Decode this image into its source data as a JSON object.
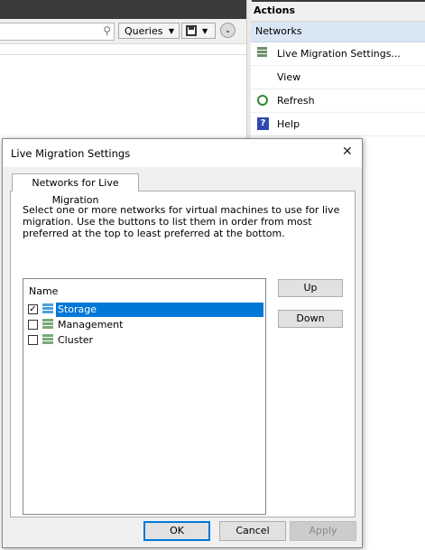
{
  "console": {
    "queries_label": "Queries",
    "dropdown_glyph": "▼",
    "search_glyph": "⚲",
    "collapse_glyph": "⌄"
  },
  "actions": {
    "header": "Actions",
    "section": "Networks",
    "items": [
      {
        "label": "Live Migration Settings...",
        "icon": "network-settings-icon"
      },
      {
        "label": "View",
        "icon": ""
      },
      {
        "label": "Refresh",
        "icon": "refresh-icon"
      },
      {
        "label": "Help",
        "icon": "help-icon",
        "glyph": "?"
      }
    ]
  },
  "dialog": {
    "title": "Live Migration Settings",
    "close_glyph": "✕",
    "tab_label": "Networks for Live Migration",
    "instructions": "Select one or more networks for virtual machines to use for live migration. Use the buttons to list them in order from most preferred at the top to least preferred at the bottom.",
    "list_header": "Name",
    "networks": [
      {
        "name": "Storage",
        "checked": true,
        "selected": true
      },
      {
        "name": "Management",
        "checked": false,
        "selected": false
      },
      {
        "name": "Cluster",
        "checked": false,
        "selected": false
      }
    ],
    "check_glyph": "✓",
    "up_label": "Up",
    "down_label": "Down",
    "ok_label": "OK",
    "cancel_label": "Cancel",
    "apply_label": "Apply"
  },
  "colors": {
    "selection": "#0078d7",
    "actions_section_bg": "#d9e7f5",
    "titlebar_dark": "#3a3a3a"
  }
}
